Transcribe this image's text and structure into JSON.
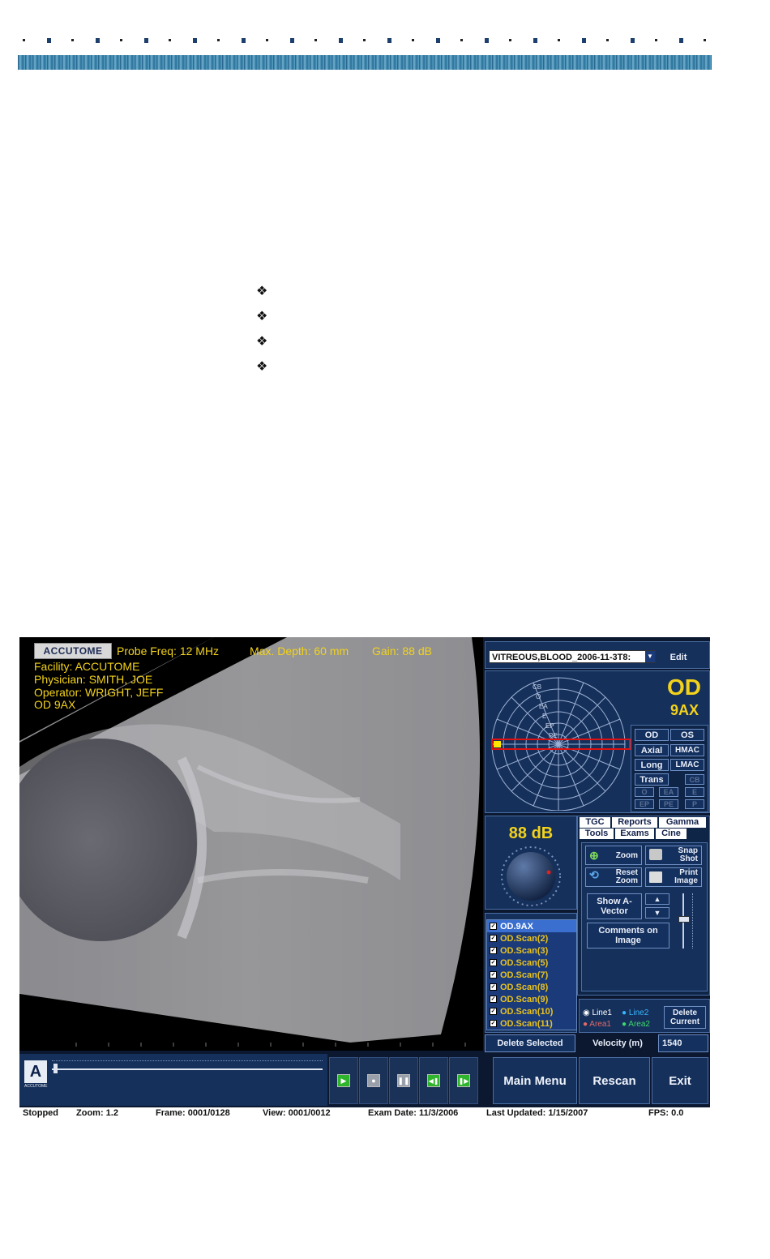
{
  "ui": {
    "overlay": {
      "logo": "ACCUTOME",
      "probe_freq": "Probe Freq: 12 MHz",
      "max_depth": "Max. Depth: 60 mm",
      "gain": "Gain: 88 dB",
      "facility": "Facility: ACCUTOME",
      "physician": "Physician: SMITH, JOE",
      "operator": "Operator: WRIGHT, JEFF",
      "view": "OD  9AX"
    },
    "select_current_exam": {
      "value": "VITREOUS,BLOOD_2006-11-3T8:",
      "edit_label": "Edit"
    },
    "current_view": {
      "eye": "OD",
      "view": "9AX",
      "ring_labels": [
        "CB",
        "O",
        "EA",
        "E",
        "EP",
        "PE"
      ]
    },
    "eye_buttons": {
      "od": "OD",
      "os": "OS",
      "axial": "Axial",
      "hmac": "HMAC",
      "long": "Long",
      "lmac": "LMAC",
      "trans": "Trans",
      "cb": "CB",
      "o": "O",
      "ea": "EA",
      "e": "E",
      "ep": "EP",
      "pe": "PE",
      "p": "P"
    },
    "gain_panel": {
      "value": "88 dB"
    },
    "tabs_row1": [
      "TGC",
      "Reports",
      "Gamma"
    ],
    "tabs_row2": [
      "Tools",
      "Exams",
      "Cine"
    ],
    "tools": {
      "zoom": "Zoom",
      "snap_shot": "Snap Shot",
      "reset_zoom": "Reset Zoom",
      "print_image": "Print Image",
      "show_a_vector": "Show A-Vector",
      "comments_on_image": "Comments on Image"
    },
    "views_to_review": [
      "OD.9AX",
      "OD.Scan(2)",
      "OD.Scan(3)",
      "OD.Scan(5)",
      "OD.Scan(7)",
      "OD.Scan(8)",
      "OD.Scan(9)",
      "OD.Scan(10)",
      "OD.Scan(11)"
    ],
    "delete_selected": "Delete Selected",
    "measurements": {
      "line1": "Line1",
      "line2": "Line2",
      "area1": "Area1",
      "area2": "Area2",
      "delete_current": "Delete Current"
    },
    "velocity": {
      "label": "Velocity (m)",
      "value": "1540"
    },
    "bottom": {
      "logo_text": "ACCUTOME",
      "main_menu": "Main Menu",
      "rescan": "Rescan",
      "exit": "Exit"
    },
    "status": {
      "state": "Stopped",
      "zoom": "Zoom: 1.2",
      "frame": "Frame: 0001/0128",
      "view": "View: 0001/0012",
      "exam_date": "Exam Date: 11/3/2006",
      "last_updated": "Last Updated: 1/15/2007",
      "fps": "FPS: 0.0"
    },
    "colors": {
      "accent_yellow": "#f2d21b",
      "panel_blue": "#15305a",
      "selected_blue": "#3a6fd0"
    }
  }
}
